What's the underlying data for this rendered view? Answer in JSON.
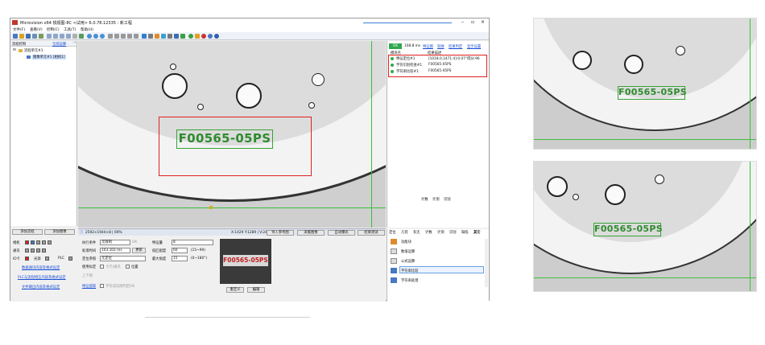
{
  "window": {
    "title": "Microvision x64 锐视图-8C <试用> 6.0.78.12335 : 新工程"
  },
  "menu": [
    {
      "label": "文件(F)"
    },
    {
      "label": "查看(V)"
    },
    {
      "label": "控制(C)"
    },
    {
      "label": "工具(T)"
    },
    {
      "label": "帮助(H)"
    }
  ],
  "left": {
    "header": "流程控制",
    "header_link": "全部运算",
    "tree": {
      "root": "流程单元#1",
      "child": "图像单元#1 [相机1]"
    },
    "add_flow_button": "添加流程",
    "add_image_button": "添加图像"
  },
  "devices": {
    "row1": "相机",
    "row2": "通讯",
    "row3_a": "IO卡",
    "row3_b": "光源",
    "row3_c": "PLC",
    "link1": "数据通讯内容及格式设定",
    "link2": "PLC与流程相互内容及格式设定",
    "link3": "文件输出内容及格式设定"
  },
  "ocr_text": "F00565-05PS",
  "status": {
    "info": "2592×1944×8 | 69%",
    "coords": "X:1429 Y:1289 | V:249"
  },
  "canvas_buttons": [
    "导入参考图",
    "采集图像",
    "自动曝光",
    "结果测试"
  ],
  "params": {
    "exec_condition_label": "执行条件",
    "exec_condition_value": "无限制",
    "ok_label": "OK",
    "proc_time_label": "处理时间",
    "proc_time_value": "103.102 ms",
    "update_button": "更新",
    "position_ref_label": "定位参照",
    "position_ref_value": "无定位",
    "use_calib_label": "使用标定",
    "calib_check_label": "卡尺/通讯",
    "position_check_label": "位置",
    "up_label": "上下限",
    "extract_link": "特征提取",
    "save_check_label": "字符成功则判定OK",
    "feature_label": "特征量",
    "feature_value": "8",
    "match_label": "低匹配度",
    "match_value": "60",
    "match_range": "(15~99)",
    "angle_label": "最大角度",
    "angle_value": "15",
    "angle_range": "(0~180°)",
    "redefine_button": "重定义",
    "edit_button": "编辑"
  },
  "results": {
    "ok_badge": "OK",
    "time": "108.8 ms",
    "links": [
      "特征图",
      "轮廓",
      "结果判定",
      "显示设置"
    ],
    "col1": "模块名",
    "col2": "结果描述",
    "rows": [
      {
        "name": "特征定位#1",
        "desc": "[1018.0,1471.4]-0.07°得分:96"
      },
      {
        "name": "字符识别检查#1",
        "desc": "F00565-05PS"
      },
      {
        "name": "字符串比较#1",
        "desc": "F00565-05PS"
      }
    ],
    "tabs_mid": [
      "计数",
      "计测",
      "识别"
    ]
  },
  "tool_tabs": [
    "定位",
    "几何",
    "有无",
    "计数",
    "计测",
    "识别",
    "缺陷",
    "其它"
  ],
  "tools": [
    {
      "label": "功能块"
    },
    {
      "label": "数值运算"
    },
    {
      "label": "公式运算"
    },
    {
      "label": "字符串比较"
    },
    {
      "label": "字符串处理"
    }
  ],
  "colors": {
    "ok_green": "#2fa84f",
    "red_box": "#e02020",
    "ocr_green": "#2e8b2e"
  }
}
